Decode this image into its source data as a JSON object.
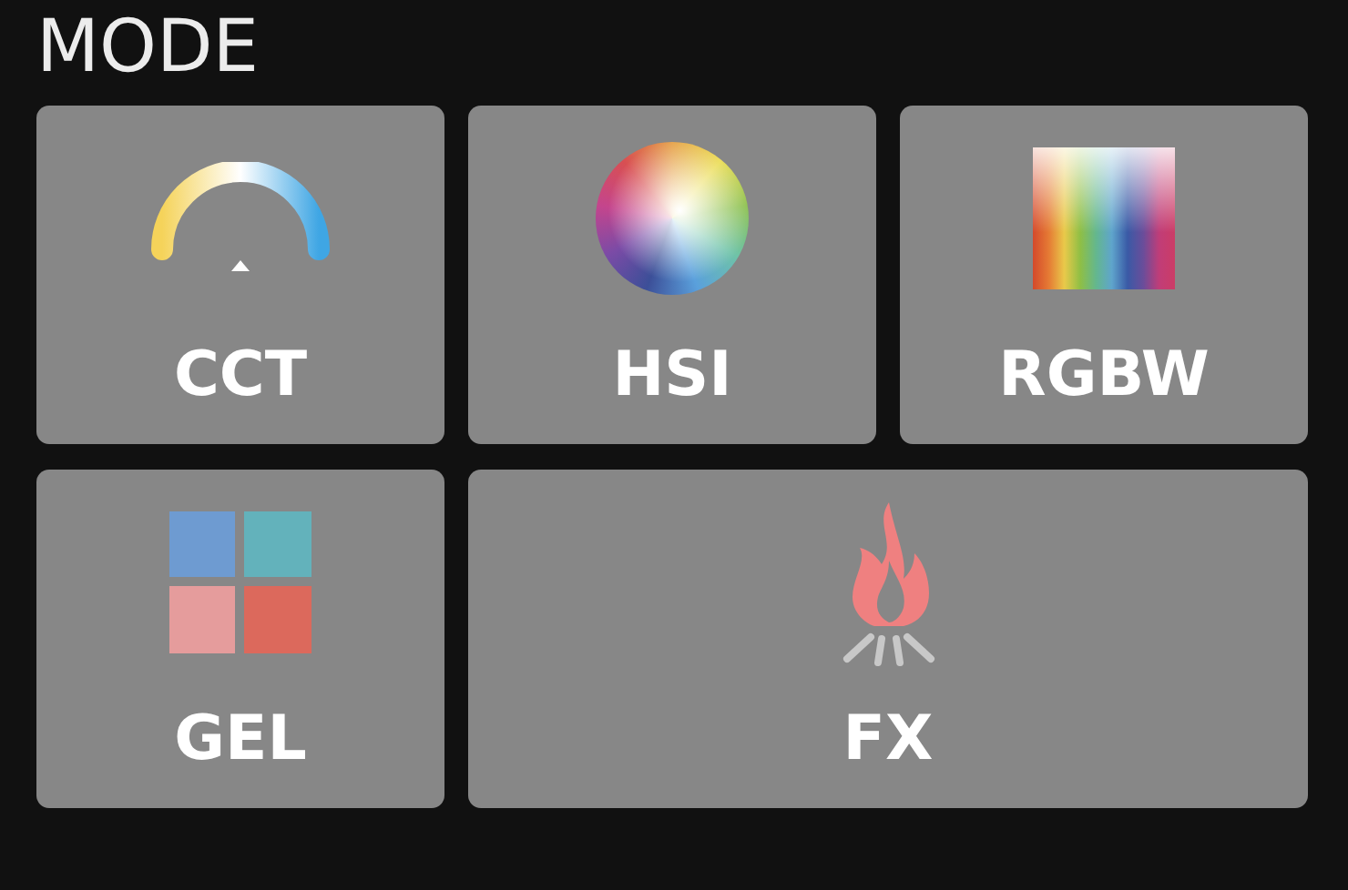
{
  "title": "MODE",
  "modes": [
    {
      "label": "CCT",
      "kind": "cct",
      "wide": false
    },
    {
      "label": "HSI",
      "kind": "hsi",
      "wide": false
    },
    {
      "label": "RGBW",
      "kind": "rgbw",
      "wide": false
    },
    {
      "label": "GEL",
      "kind": "gel",
      "wide": false
    },
    {
      "label": "FX",
      "kind": "fx",
      "wide": true
    }
  ]
}
